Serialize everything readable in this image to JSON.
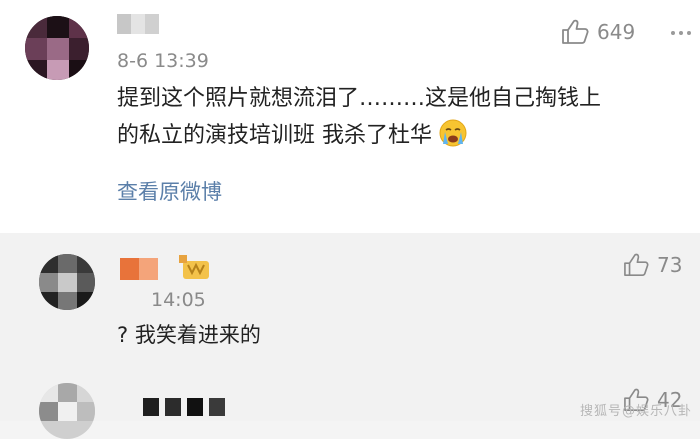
{
  "main_comment": {
    "time": "8-6 13:39",
    "like_count": "649",
    "content_line1": "提到这个照片就想流泪了………这是他自己掏钱上",
    "content_line2": "的私立的演技培训班 我杀了杜华",
    "view_original": "查看原微博"
  },
  "replies": [
    {
      "time": "14:05",
      "like_count": "73",
      "content": "? 我笑着进来的"
    },
    {
      "like_count": "42"
    }
  ],
  "watermark": "搜狐号@娱乐八卦"
}
